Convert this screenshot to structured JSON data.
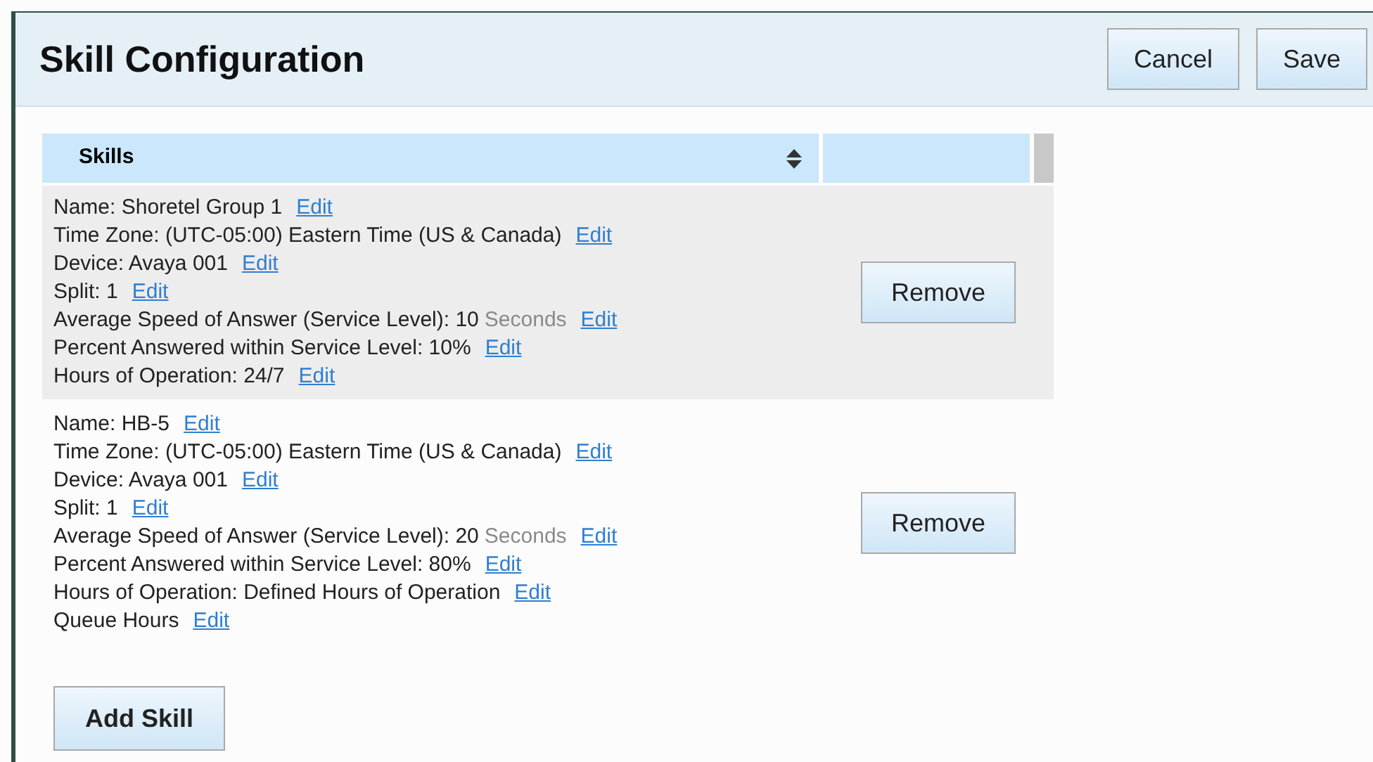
{
  "header": {
    "title": "Skill Configuration",
    "buttons": [
      "Cancel",
      "Save"
    ]
  },
  "table": {
    "columns": [
      "Skills"
    ],
    "rows": [
      {
        "shaded": true,
        "button": "Remove",
        "lines": [
          {
            "text": "Name: Shoretel Group 1",
            "link": "Edit"
          },
          {
            "text": "Time Zone: (UTC-05:00) Eastern Time (US & Canada)",
            "link": "Edit"
          },
          {
            "text": "Device: Avaya 001",
            "link": "Edit"
          },
          {
            "text": "Split: 1",
            "link": "Edit"
          },
          {
            "text": "Average Speed of Answer (Service Level): 10",
            "unit": "Seconds",
            "link": "Edit"
          },
          {
            "text": "Percent Answered within Service Level: 10%",
            "link": "Edit"
          },
          {
            "text": "Hours of Operation: 24/7",
            "link": "Edit"
          }
        ]
      },
      {
        "shaded": false,
        "button": "Remove",
        "lines": [
          {
            "text": "Name: HB-5",
            "link": "Edit"
          },
          {
            "text": "Time Zone: (UTC-05:00) Eastern Time (US & Canada)",
            "link": "Edit"
          },
          {
            "text": "Device: Avaya 001",
            "link": "Edit"
          },
          {
            "text": "Split: 1",
            "link": "Edit"
          },
          {
            "text": "Average Speed of Answer (Service Level): 20",
            "unit": "Seconds",
            "link": "Edit"
          },
          {
            "text": "Percent Answered within Service Level: 80%",
            "link": "Edit"
          },
          {
            "text": "Hours of Operation: Defined Hours of Operation",
            "link": "Edit"
          },
          {
            "text": "Queue Hours",
            "link": "Edit"
          }
        ]
      }
    ]
  },
  "add_button": "Add Skill"
}
